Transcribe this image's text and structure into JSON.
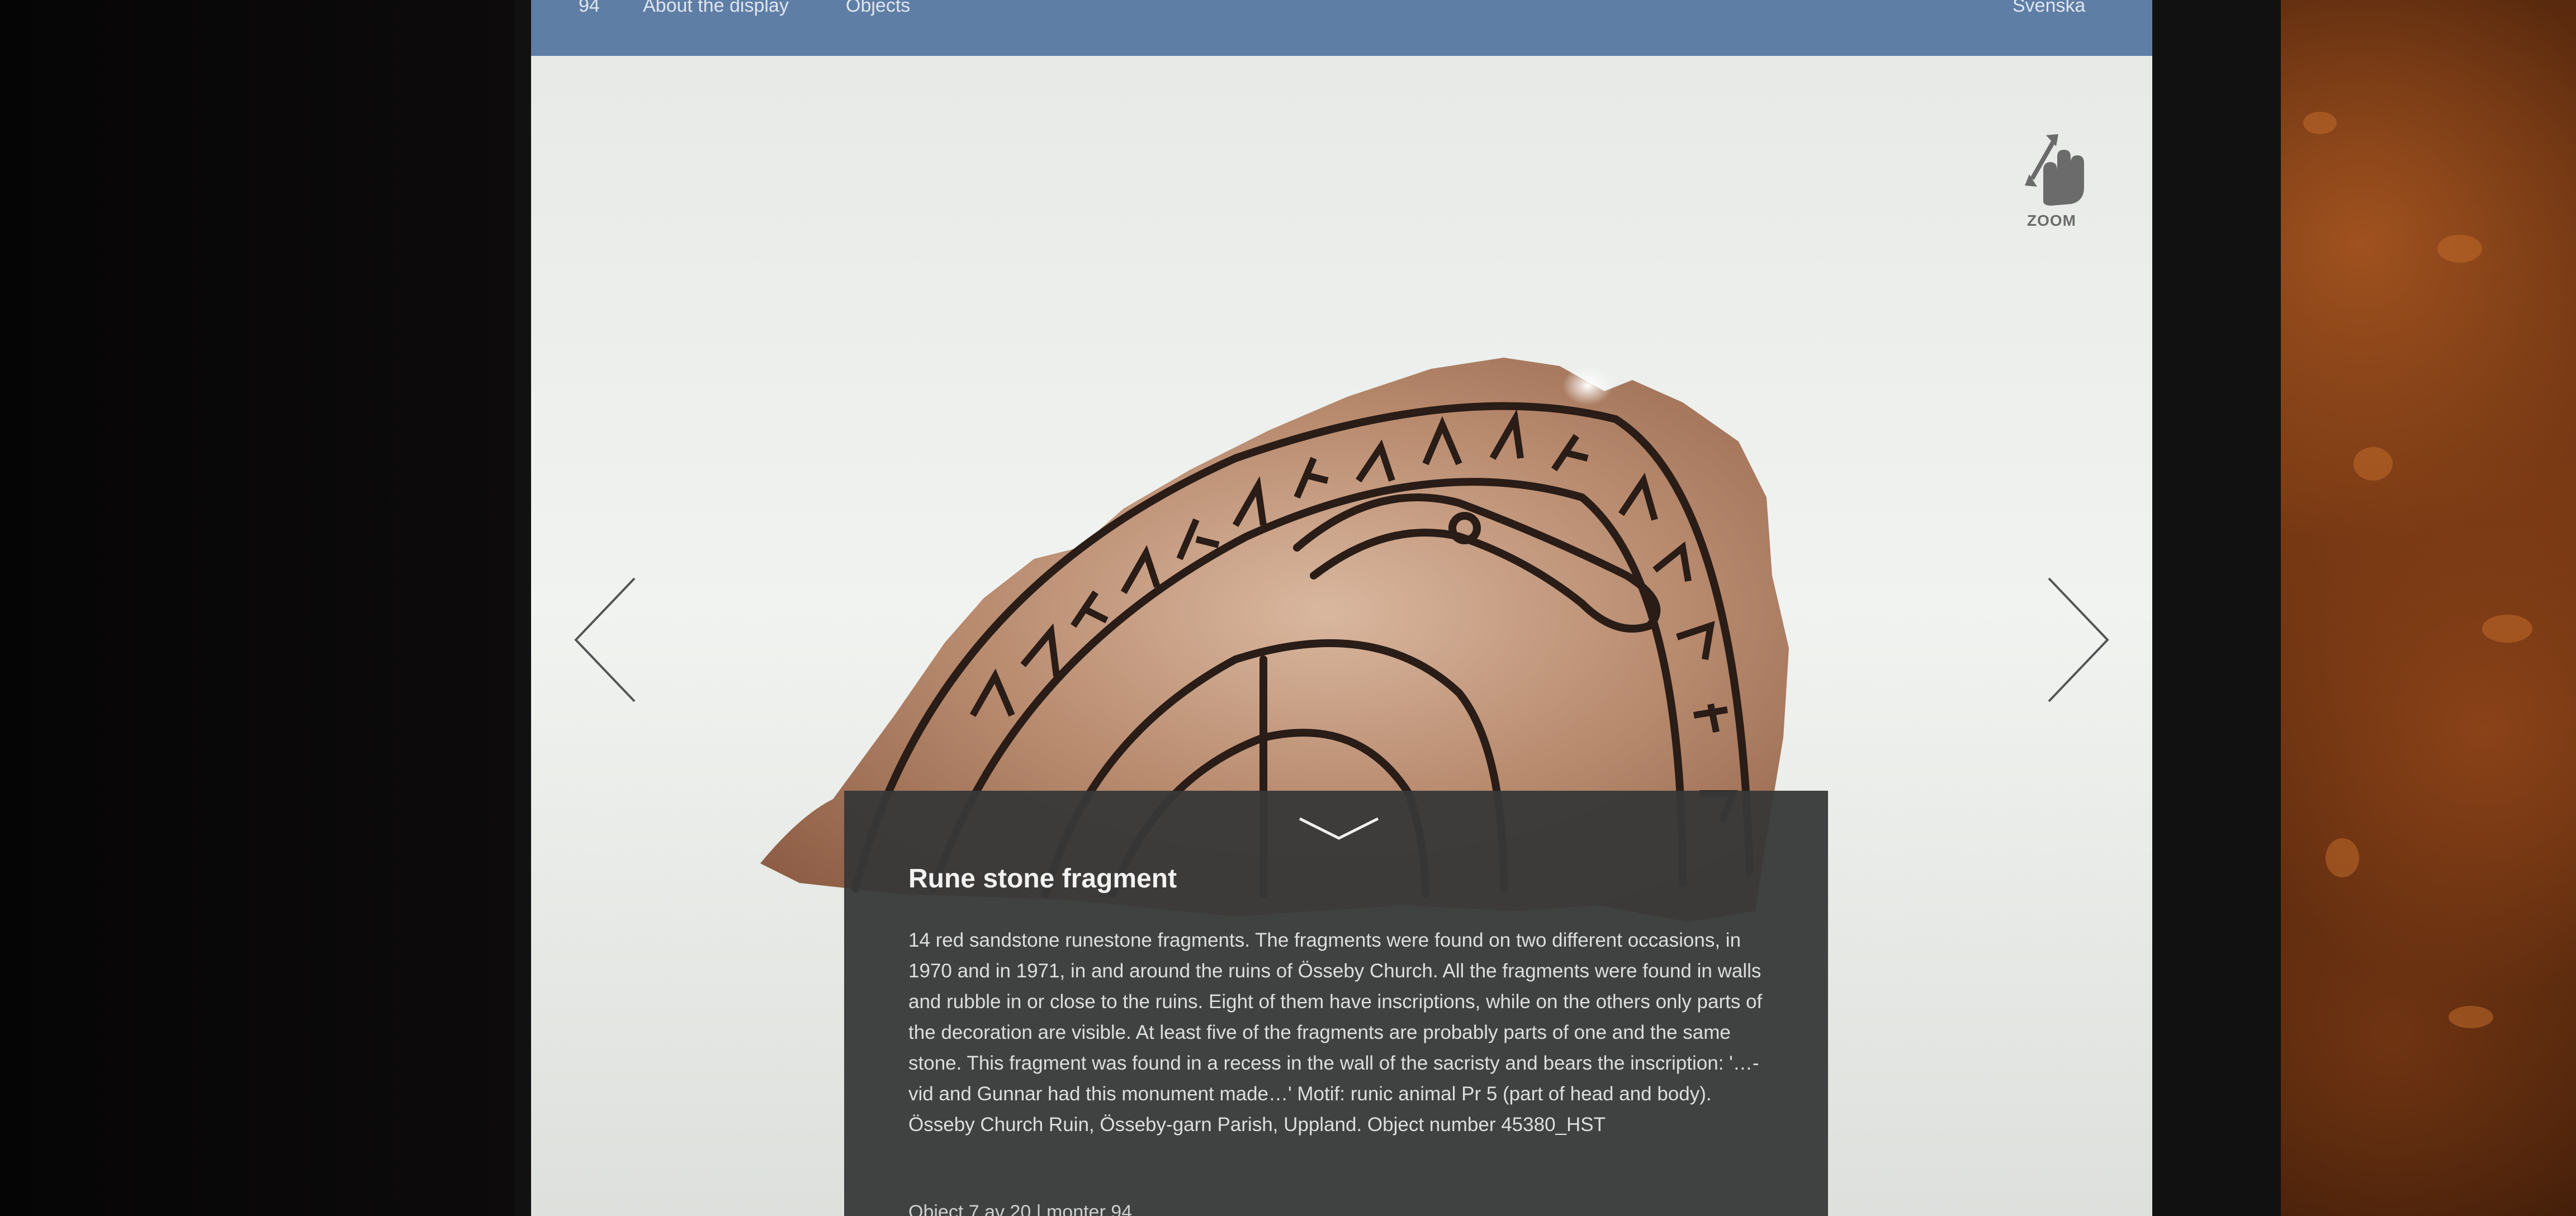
{
  "nav": {
    "number": "94",
    "about": "About the display",
    "objects": "Objects",
    "language": "Svenska"
  },
  "zoom": {
    "label": "ZOOM",
    "icon": "pinch-zoom-icon"
  },
  "icons": {
    "prev": "chevron-left-icon",
    "next": "chevron-right-icon",
    "collapse": "chevron-down-icon"
  },
  "object": {
    "title": "Rune stone fragment",
    "description": "14 red sandstone runestone fragments. The fragments were found on two different occasions, in 1970 and in 1971, in and around the ruins of Össeby Church. All the fragments were found in walls and rubble in or close to the ruins. Eight of them have inscriptions, while on the others only parts of the decoration are visible. At least five of the fragments are probably parts of one and the same stone. This fragment was found in a recess in the wall of the sacristy and bears the inscription: '…-vid and Gunnar had this monument made…' Motif: runic animal Pr 5 (part of head and body). Össeby Church Ruin, Össeby-garn Parish, Uppland. Object number 45380_HST",
    "counter": "Object 7 av 20 | monter 94"
  },
  "colors": {
    "topbar": "#5f7ea6",
    "panel": "#373838",
    "stone": "#b88a6e"
  }
}
